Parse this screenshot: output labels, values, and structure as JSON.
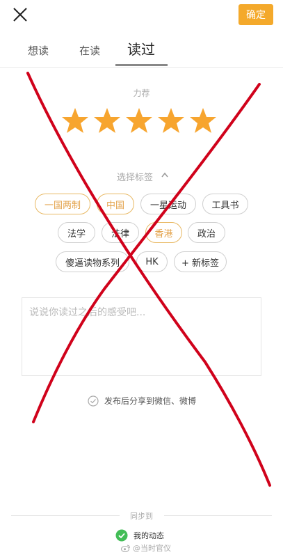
{
  "header": {
    "close_icon": "close-icon",
    "confirm_label": "确定",
    "accent_color": "#f4a92b"
  },
  "tabs": [
    {
      "label": "想读",
      "active": false
    },
    {
      "label": "在读",
      "active": false
    },
    {
      "label": "读过",
      "active": true
    }
  ],
  "rating": {
    "label": "力荐",
    "stars_filled": 5,
    "stars_total": 5,
    "star_color": "#f7a52f"
  },
  "tags": {
    "label": "选择标签",
    "items": [
      {
        "label": "一国两制",
        "selected": true
      },
      {
        "label": "中国",
        "selected": true
      },
      {
        "label": "一星运动",
        "selected": false
      },
      {
        "label": "工具书",
        "selected": false
      },
      {
        "label": "法学",
        "selected": false
      },
      {
        "label": "法律",
        "selected": false
      },
      {
        "label": "香港",
        "selected": true
      },
      {
        "label": "政治",
        "selected": false
      },
      {
        "label": "傻逼读物系列",
        "selected": false
      },
      {
        "label": "HK",
        "selected": false
      },
      {
        "label": "+ 新标签",
        "selected": false
      }
    ]
  },
  "review": {
    "placeholder": "说说你读过之后的感受吧..."
  },
  "share": {
    "label": "发布后分享到微信、微博"
  },
  "sync": {
    "label": "同步到",
    "my_feed_label": "我的动态",
    "my_feed_checked": true
  },
  "watermark": "@当时官仪",
  "overlay": {
    "type": "red-x",
    "color": "#d0021b"
  }
}
